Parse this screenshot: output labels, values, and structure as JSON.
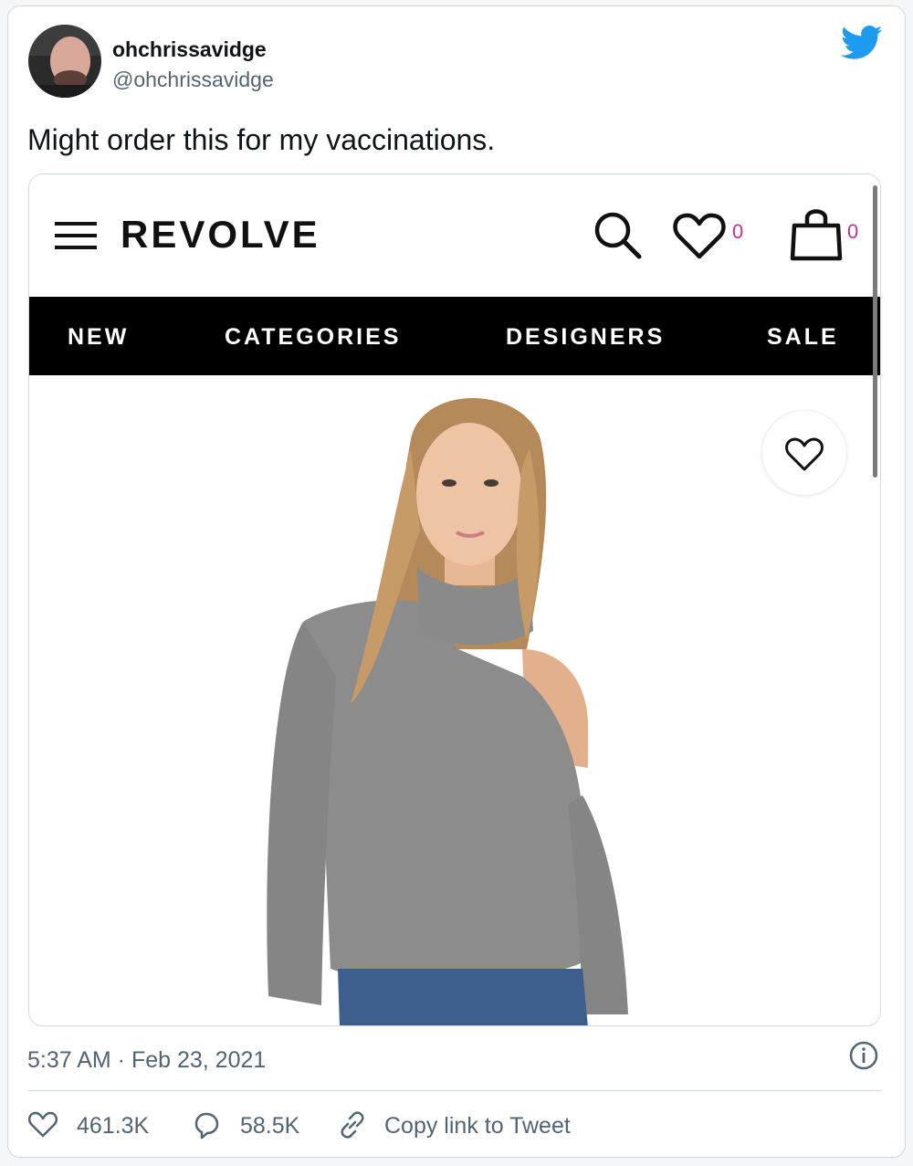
{
  "tweet": {
    "author": {
      "name": "ohchrissavidge",
      "handle": "@ohchrissavidge"
    },
    "text": "Might order this for my vaccinations.",
    "timestamp": "5:37 AM · Feb 23, 2021",
    "actions": {
      "likes": "461.3K",
      "replies": "58.5K",
      "copy_link": "Copy link to Tweet"
    },
    "colors": {
      "twitter_blue": "#1d9bf0",
      "muted_text": "#536471",
      "border": "#cfd9de"
    }
  },
  "screenshot": {
    "brand": "REVOLVE",
    "wishlist_count": "0",
    "bag_count": "0",
    "nav_items": [
      "NEW",
      "CATEGORIES",
      "DESIGNERS",
      "SALE"
    ],
    "count_color": "#c0348c",
    "icons": [
      "hamburger-menu-icon",
      "search-icon",
      "heart-icon",
      "shopping-bag-icon"
    ]
  }
}
